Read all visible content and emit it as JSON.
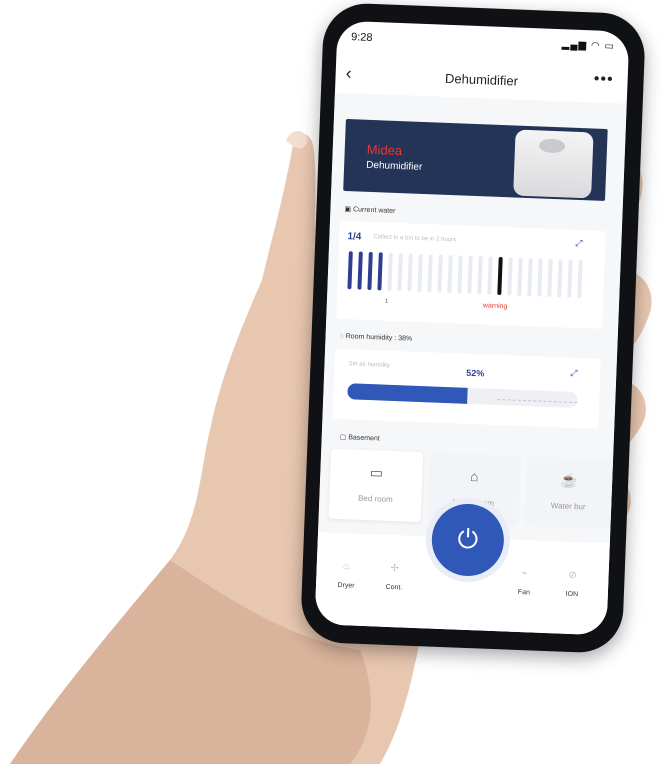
{
  "status": {
    "time": "9:28",
    "signal_icons": "▂▄▆ ◠ ▭"
  },
  "nav": {
    "back_icon": "‹",
    "title": "Dehumidifier",
    "more_icon": "•••"
  },
  "banner": {
    "brand": "Midea",
    "subtitle": "Dehumidifier"
  },
  "water": {
    "label": "Current water",
    "level": "1/4",
    "hint": "Collect to a bin to be in 2 hours",
    "scale_1": "1",
    "warning": "warning",
    "fraction": 0.25
  },
  "humidity": {
    "label": "Room humidity : 38%",
    "sub_label": "Set air humidity",
    "value": "52%",
    "fraction": 0.52
  },
  "room": {
    "label": "Basement",
    "tiles": [
      {
        "icon": "▭",
        "label": "Bed room"
      },
      {
        "icon": "⌂",
        "label": "Living room"
      },
      {
        "icon": "☕",
        "label": "Water bur"
      }
    ]
  },
  "modes": [
    {
      "icon": "♨",
      "label": "Dryer"
    },
    {
      "icon": "✢",
      "label": "Cont."
    },
    {
      "icon": "⌁",
      "label": "Fan"
    },
    {
      "icon": "⊘",
      "label": "ION"
    }
  ],
  "colors": {
    "accent": "#2f58b8",
    "banner": "#243457",
    "brand": "#e53935",
    "warning": "#e53935"
  }
}
